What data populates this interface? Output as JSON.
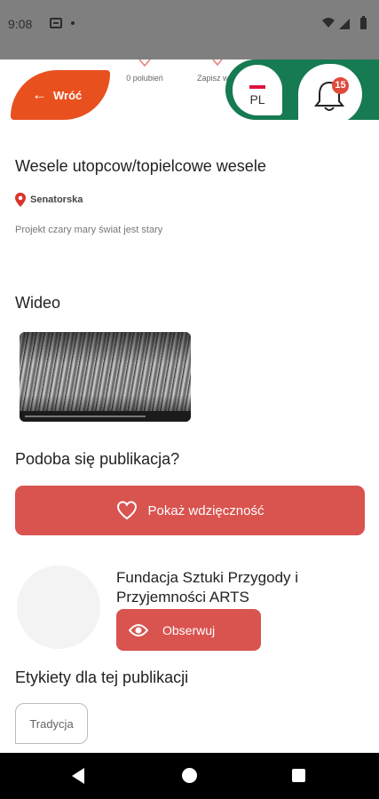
{
  "status_bar": {
    "time": "9:08"
  },
  "header": {
    "likes_label": "0 polubień",
    "save_label": "Zapisz w",
    "back_label": "Wróć",
    "language_code": "PL",
    "notification_count": "15"
  },
  "publication": {
    "title": "Wesele utopcow/topielcowe wesele",
    "location": "Senatorska",
    "description": "Projekt czary mary świat jest stary"
  },
  "video_section": {
    "heading": "Wideo"
  },
  "like_section": {
    "question": "Podoba się publikacja?",
    "button_label": "Pokaż wdzięczność"
  },
  "organization": {
    "name": "Fundacja Sztuki Przygody i Przyjemności ARTS",
    "follow_label": "Obserwuj"
  },
  "tags_section": {
    "heading": "Etykiety dla tej publikacji",
    "tags": [
      "Tradycja"
    ]
  },
  "colors": {
    "accent_orange": "#e8501e",
    "accent_green": "#167a52",
    "button_red": "#d9534f"
  },
  "icons": [
    "heart-icon",
    "bookmark-icon",
    "arrow-left-icon",
    "bell-icon",
    "map-pin-icon",
    "eye-icon",
    "flag-icon"
  ]
}
